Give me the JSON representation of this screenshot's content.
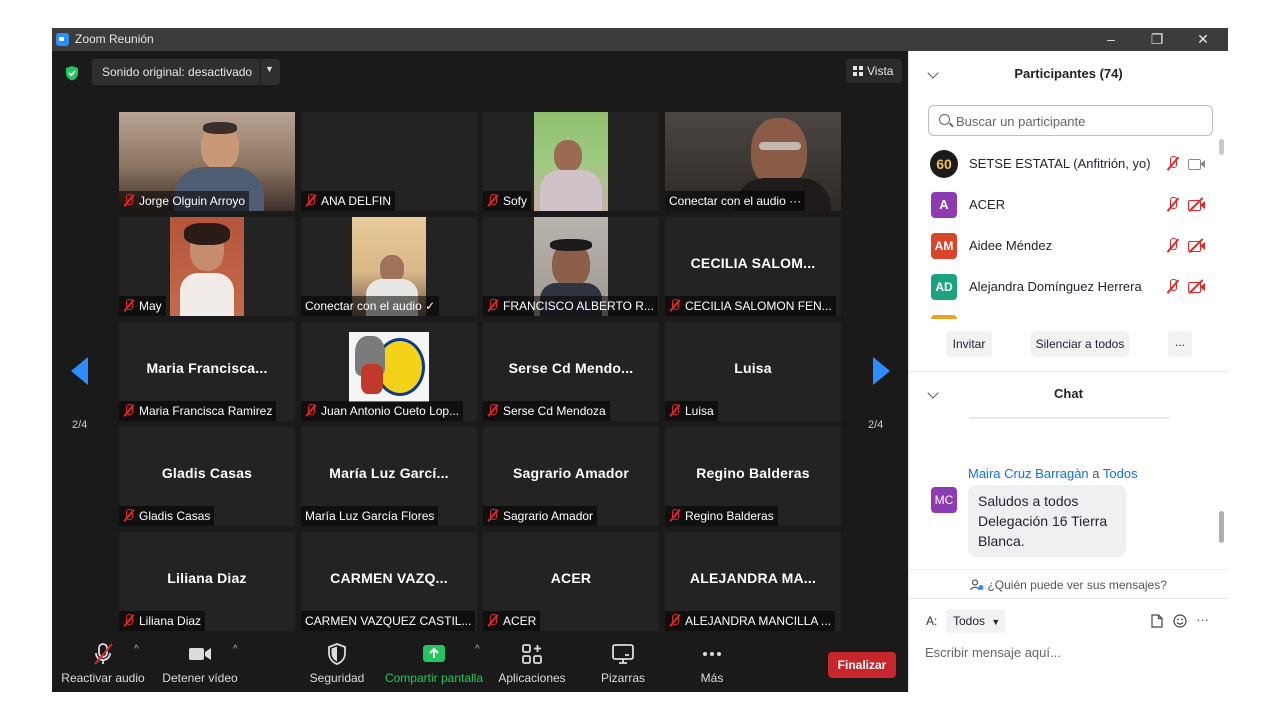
{
  "window": {
    "title": "Zoom Reunión",
    "controls": [
      "–",
      "❐",
      "✕"
    ]
  },
  "top_bar": {
    "sound_button": "Sonido original: desactivado",
    "view_button": "Vista"
  },
  "pagination": {
    "left": "2/4",
    "right": "2/4"
  },
  "tiles": [
    {
      "name": "",
      "label": "Jorge Olguin Arroyo",
      "muted": true,
      "video": true
    },
    {
      "name": "",
      "label": "ANA DELFIN",
      "muted": true,
      "video": false
    },
    {
      "name": "",
      "label": "Sofy",
      "muted": true,
      "video": true
    },
    {
      "name": "",
      "label": "Conectar con el audio ···",
      "muted": false,
      "video": true
    },
    {
      "name": "",
      "label": "May",
      "muted": true,
      "video": true
    },
    {
      "name": "",
      "label": "Conectar con el audio ✓",
      "muted": false,
      "video": true
    },
    {
      "name": "",
      "label": "FRANCISCO ALBERTO R...",
      "muted": true,
      "video": true
    },
    {
      "name": "CECILIA SALOM...",
      "label": "CECILIA SALOMON FEN...",
      "muted": true,
      "video": false
    },
    {
      "name": "Maria Francisca...",
      "label": "Maria Francisca Ramirez",
      "muted": true,
      "video": false
    },
    {
      "name": "",
      "label": "Juan Antonio Cueto Lop...",
      "muted": true,
      "video": true
    },
    {
      "name": "Serse Cd Mendo...",
      "label": "Serse Cd Mendoza",
      "muted": true,
      "video": false
    },
    {
      "name": "Luisa",
      "label": "Luisa",
      "muted": true,
      "video": false
    },
    {
      "name": "Gladis Casas",
      "label": "Gladis Casas",
      "muted": true,
      "video": false
    },
    {
      "name": "María Luz Garcí...",
      "label": "María Luz García Flores",
      "muted": false,
      "video": false
    },
    {
      "name": "Sagrario Amador",
      "label": "Sagrario Amador",
      "muted": true,
      "video": false
    },
    {
      "name": "Regino Balderas",
      "label": "Regino Balderas",
      "muted": true,
      "video": false
    },
    {
      "name": "Liliana Diaz",
      "label": "Liliana Diaz",
      "muted": true,
      "video": false
    },
    {
      "name": "CARMEN VAZQ...",
      "label": "CARMEN VAZQUEZ CASTIL...",
      "muted": false,
      "video": false
    },
    {
      "name": "ACER",
      "label": "ACER",
      "muted": true,
      "video": false
    },
    {
      "name": "ALEJANDRA MA...",
      "label": "ALEJANDRA MANCILLA ...",
      "muted": true,
      "video": false
    }
  ],
  "toolbar": {
    "unmute": "Reactivar audio",
    "stop_video": "Detener vídeo",
    "security": "Seguridad",
    "share": "Compartir pantalla",
    "apps": "Aplicaciones",
    "whiteboards": "Pizarras",
    "more": "Más",
    "end": "Finalizar"
  },
  "participants_panel": {
    "title": "Participantes (74)",
    "search_placeholder": "Buscar un participante",
    "list": [
      {
        "avatar": "60",
        "avatar_color": "#1b1b1b",
        "name": "SETSE ESTATAL (Anfitrión, yo)"
      },
      {
        "avatar": "A",
        "avatar_color": "#8d3bb0",
        "name": "ACER"
      },
      {
        "avatar": "AM",
        "avatar_color": "#d9452b",
        "name": "Aidee Méndez"
      },
      {
        "avatar": "AD",
        "avatar_color": "#1ba37f",
        "name": "Alejandra Domínguez Herrera"
      }
    ],
    "buttons": {
      "invite": "Invitar",
      "mute_all": "Silenciar a todos",
      "more": "..."
    }
  },
  "chat_panel": {
    "title": "Chat",
    "message": {
      "sender": "Maira Cruz Barragàn",
      "to_word": "a",
      "recipient": "Todos",
      "avatar": "MC",
      "text": "Saludos a todos Delegación 16 Tierra Blanca."
    },
    "who_can_see": "¿Quién puede ver sus mensajes?",
    "to_label": "A:",
    "to_value": "Todos",
    "input_placeholder": "Escribir mensaje aquí...",
    "more": "···"
  },
  "colors": {
    "accent": "#2d8cff",
    "end_red": "#c9252c",
    "share_green": "#22c55e",
    "muted_red": "#e02828"
  }
}
